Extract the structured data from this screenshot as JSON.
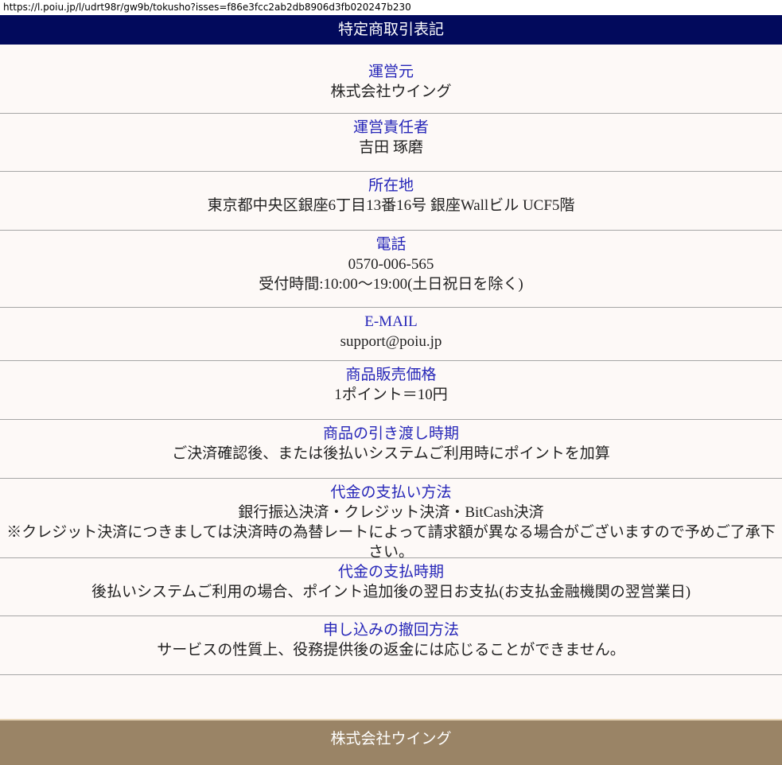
{
  "url": "https://l.poiu.jp/l/udrt98r/gw9b/tokusho?isses=f86e3fcc2ab2db8906d3fb020247b230",
  "header": {
    "title": "特定商取引表記"
  },
  "items": [
    {
      "label": "運営元",
      "values": [
        "株式会社ウイング"
      ]
    },
    {
      "label": "運営責任者",
      "values": [
        "吉田 琢磨"
      ]
    },
    {
      "label": "所在地",
      "values": [
        "東京都中央区銀座6丁目13番16号 銀座Wallビル UCF5階"
      ]
    },
    {
      "label": "電話",
      "values": [
        "0570-006-565",
        "受付時間:10:00〜19:00(土日祝日を除く)"
      ]
    },
    {
      "label": "E-MAIL",
      "values": [
        "support@poiu.jp"
      ]
    },
    {
      "label": "商品販売価格",
      "values": [
        "1ポイント＝10円"
      ]
    },
    {
      "label": "商品の引き渡し時期",
      "values": [
        "ご決済確認後、または後払いシステムご利用時にポイントを加算"
      ]
    },
    {
      "label": "代金の支払い方法",
      "values": [
        "銀行振込決済・クレジット決済・BitCash決済",
        "※クレジット決済につきましては決済時の為替レートによって請求額が異なる場合がございますので予めご了承下さい。"
      ]
    },
    {
      "label": "代金の支払時期",
      "values": [
        "後払いシステムご利用の場合、ポイント追加後の翌日お支払(お支払金融機関の翌営業日)"
      ]
    },
    {
      "label": "申し込みの撤回方法",
      "values": [
        "サービスの性質上、役務提供後の返金には応じることができません。"
      ]
    }
  ],
  "footer": {
    "company": "株式会社ウイング"
  }
}
